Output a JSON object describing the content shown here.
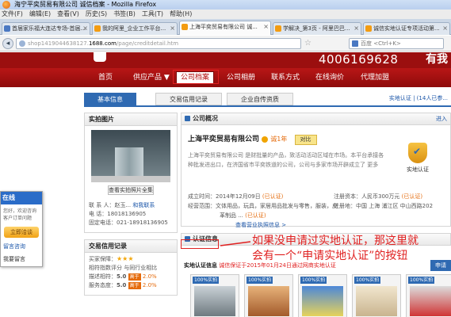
{
  "window": {
    "title": "海宁平奕贸易有限公司 诚信档案 - Mozilla Firefox"
  },
  "menu": [
    "文件(F)",
    "编辑(E)",
    "查看(V)",
    "历史(S)",
    "书签(B)",
    "工具(T)",
    "帮助(H)"
  ],
  "tabs": [
    {
      "label": "首届家乐福大连达专场-首届..."
    },
    {
      "label": "我的阿里_企业工作平台..."
    },
    {
      "label": "上海平奕贸易有限公司 诚..."
    },
    {
      "label": "学解决_第3页 - 阿里巴巴..."
    },
    {
      "label": "诚信实地认证专项活动第..."
    }
  ],
  "address": {
    "prefix": "shop1419044638127.",
    "domain": "1688.com",
    "path": "/page/creditdetail.htm"
  },
  "search_placeholder": "百度 <Ctrl+K>",
  "banner": {
    "phone": "4006169628",
    "more": "有我"
  },
  "main_nav": [
    "首页",
    "供应产品 ▼",
    "公司档案",
    "公司相册",
    "联系方式",
    "在线询价",
    "代理加盟"
  ],
  "sub_tabs": [
    "基本信息",
    "交易信用记录",
    "企业自传资质"
  ],
  "sub_tabs_right": "实地认证 | (14人已参...",
  "left": {
    "photo_title": "实拍图片",
    "view_all": "查看实拍照片全集",
    "contact_label": "联 系 人：",
    "contact_name": "赵玉...",
    "talk_link": "和我联系",
    "phone_label": "电      话：",
    "phone": "18018136905",
    "fixed_label": "固定电话：",
    "fixed": "021-18918136905",
    "trade_title": "交易信用记录",
    "buyer_label": "买家保障：",
    "desc_match_label": "相符指数评分",
    "industry_label": "与同行业相比",
    "desc_label": "描述相符：",
    "desc_score": "5.0",
    "desc_pct": "高于",
    "desc_pct_val": "2.0%",
    "service_label": "服务态度：",
    "service_score": "5.0",
    "service_pct": "高于",
    "service_pct_val": "2.0%"
  },
  "overview": {
    "title": "公司概况",
    "more": "进入",
    "company": "上海平奕贸易有限公司",
    "years": "诚1年",
    "contact_btn": "对比",
    "desc": "上海平奕贸易有限公司 是财批量的产品，致活动活动区域在市场。本平台承接各种批发进出口，在济国省市平奕铁道的公司，公司与多家市场开辟成立了 更多",
    "desc_more": "更多",
    "badge": "实地认证",
    "founded_label": "成立时间：",
    "founded": "2014年12月09日",
    "capital_label": "注册资本：",
    "capital": "人民币300万元",
    "auth_tag": "(已认证)",
    "scope_label": "经营范围：",
    "scope": "文体用品，玩具，家居用品批发与零售，服装，皮",
    "scope2": "革制品 ...",
    "addr_label": "注册地：",
    "addr": "中国 上海 浦江区 中山西路202",
    "more_link": "查看营业执照信息 >"
  },
  "certify": {
    "title": "认证信息",
    "sub_label": "实地认证信息",
    "sub_note": "诚信保证于2015年01月24日通过网商实地认证",
    "apply_btn": "申请",
    "thumbs": [
      "100%实拍",
      "100%实拍",
      "100%实拍",
      "100%实拍",
      "100%实拍"
    ]
  },
  "consult": {
    "title": "在线",
    "text": "您好，欢迎咨询客户订单问题",
    "button": "立即洽谈",
    "msg": "留言咨询",
    "reply": "我要留言"
  },
  "annotation": {
    "line1": "如果没申请过实地认证，那这里就",
    "line2": "会有一个“申请实地认证”的按钮"
  }
}
